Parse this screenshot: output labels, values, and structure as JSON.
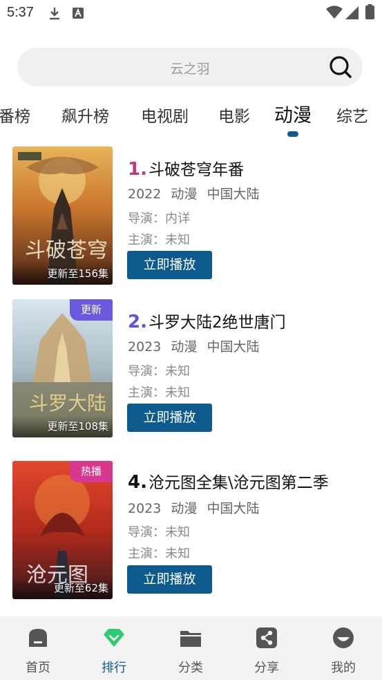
{
  "status_bar": {
    "time": "5:37"
  },
  "search": {
    "placeholder": "云之羽"
  },
  "tabs": [
    {
      "label": "番榜"
    },
    {
      "label": "飙升榜"
    },
    {
      "label": "电视剧"
    },
    {
      "label": "电影"
    },
    {
      "label": "动漫",
      "active": true
    },
    {
      "label": "综艺"
    }
  ],
  "items": [
    {
      "rank": "1.",
      "rank_color": "#c2377f",
      "title": "斗破苍穹年番",
      "year": "2022",
      "genre": "动漫",
      "region": "中国大陆",
      "director": "导演：内详",
      "cast": "主演：未知",
      "update": "更新至156集",
      "badge": "",
      "play_label": "立即播放"
    },
    {
      "rank": "2.",
      "rank_color": "#5a55d6",
      "title": "斗罗大陆2绝世唐门",
      "year": "2023",
      "genre": "动漫",
      "region": "中国大陆",
      "director": "导演：未知",
      "cast": "主演：未知",
      "update": "更新至108集",
      "badge": "更新",
      "badge_color": "#6a5ae0",
      "play_label": "立即播放"
    },
    {
      "rank": "4.",
      "rank_color": "#111111",
      "title": "沧元图全集\\沧元图第二季",
      "year": "2023",
      "genre": "动漫",
      "region": "中国大陆",
      "director": "导演：未知",
      "cast": "主演：未知",
      "update": "更新至62集",
      "badge": "热播",
      "badge_color": "#d8378e",
      "play_label": "立即播放"
    }
  ],
  "bottom_nav": [
    {
      "label": "首页",
      "icon": "home-icon"
    },
    {
      "label": "排行",
      "icon": "diamond-icon",
      "active": true
    },
    {
      "label": "分类",
      "icon": "folder-icon"
    },
    {
      "label": "分享",
      "icon": "share-icon"
    },
    {
      "label": "我的",
      "icon": "profile-icon"
    }
  ],
  "colors": {
    "accent": "#0d5b8e",
    "active_nav_icon": "#2ecc71"
  }
}
